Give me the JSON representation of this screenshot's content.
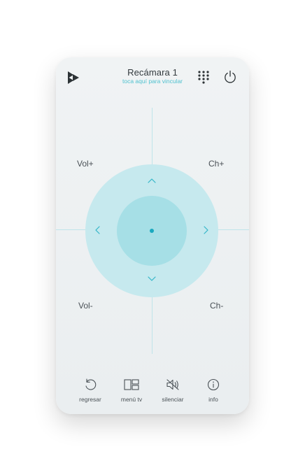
{
  "header": {
    "title": "Recámara 1",
    "subtitle": "toca aquí para vincular"
  },
  "icons": {
    "logo": "play-triangles-logo",
    "keypad": "keypad-grid-icon",
    "power": "power-icon",
    "up": "chevron-up-icon",
    "down": "chevron-down-icon",
    "left": "chevron-left-icon",
    "right": "chevron-right-icon"
  },
  "controls": {
    "vol_up": "Vol+",
    "ch_up": "Ch+",
    "vol_down": "Vol-",
    "ch_down": "Ch-"
  },
  "bottom_bar": [
    {
      "label": "regresar",
      "icon": "back-arrow-icon"
    },
    {
      "label": "menú tv",
      "icon": "menu-grid-icon"
    },
    {
      "label": "silenciar",
      "icon": "mute-speaker-icon"
    },
    {
      "label": "info",
      "icon": "info-icon"
    }
  ],
  "colors": {
    "accent": "#4fc1cf",
    "dpad_outer": "#c6e9ee",
    "dpad_center": "#a6dfe6",
    "center_dot": "#1aa9bf"
  }
}
